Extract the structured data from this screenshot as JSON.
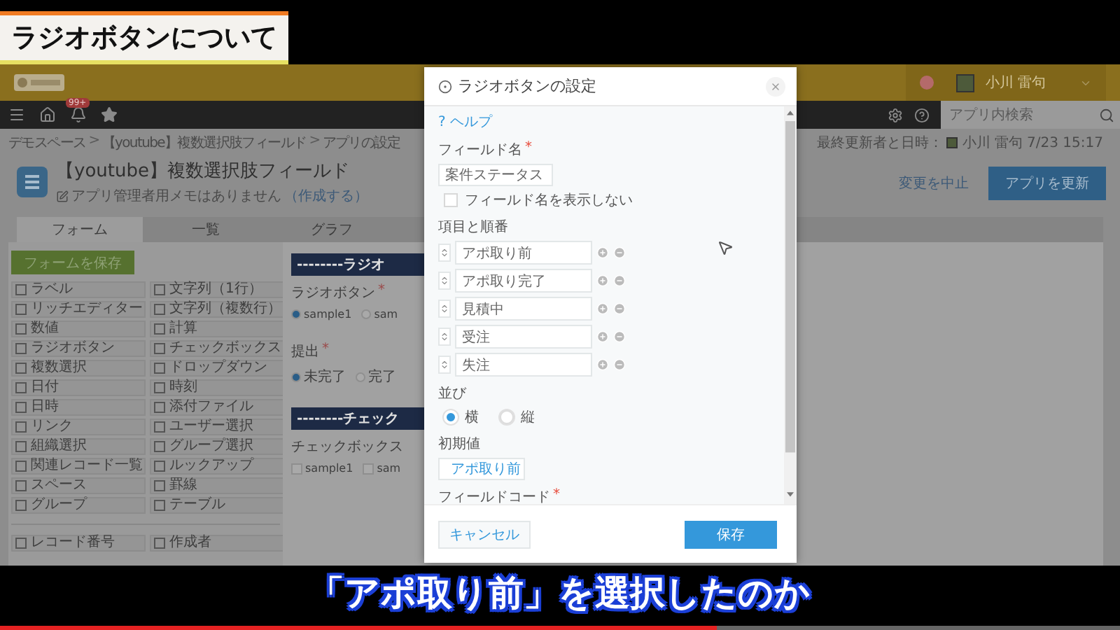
{
  "video_title": "ラジオボタンについて",
  "header": {
    "user_name": "小川 雷句",
    "notification_badge": "99+",
    "search": {
      "placeholder": "アプリ内検索"
    }
  },
  "breadcrumb": [
    {
      "kind": "link",
      "label": "デモスペース"
    },
    {
      "kind": "separator",
      "label": ">"
    },
    {
      "kind": "link",
      "label": "【youtube】複数選択肢フィールド"
    },
    {
      "kind": "separator",
      "label": ">"
    },
    {
      "kind": "link",
      "label": "アプリの設定"
    }
  ],
  "app": {
    "title": "【youtube】複数選択肢フィールド",
    "memo": "アプリ管理者用メモはありません",
    "memo_link": "（作成する）"
  },
  "last_updated": {
    "label": "最終更新者と日時：",
    "user": "小川 雷句",
    "time": "7/23 15:17"
  },
  "actions": {
    "cancel": "変更を中止",
    "update": "アプリを更新"
  },
  "tabs": [
    {
      "label": "フォーム",
      "selected": true
    },
    {
      "label": "一覧",
      "selected": false
    },
    {
      "label": "グラフ",
      "selected": false
    }
  ],
  "palette": {
    "save_button": "フォームを保存",
    "items": [
      "ラベル",
      "文字列（1行）",
      "リッチエディター",
      "文字列（複数行）",
      "数値",
      "計算",
      "ラジオボタン",
      "チェックボックス",
      "複数選択",
      "ドロップダウン",
      "日付",
      "時刻",
      "日時",
      "添付ファイル",
      "リンク",
      "ユーザー選択",
      "組織選択",
      "グループ選択",
      "関連レコード一覧",
      "ルックアップ",
      "スペース",
      "罫線",
      "グループ",
      "テーブル"
    ],
    "system_items": [
      "レコード番号",
      "作成者"
    ]
  },
  "form": {
    "sections": [
      {
        "heading": "--------ラジオ",
        "fields": [
          {
            "kind": "radio",
            "label": "ラジオボタン",
            "required_mark": "*",
            "options": [
              {
                "label": "sample1",
                "selected": true
              },
              {
                "label": "sam",
                "selected": false
              }
            ]
          },
          {
            "kind": "radio",
            "label": "提出",
            "required_mark": "*",
            "options": [
              {
                "label": "未完了",
                "selected": true
              },
              {
                "label": "完了",
                "selected": false
              }
            ]
          }
        ]
      },
      {
        "heading": "--------チェック",
        "fields": [
          {
            "kind": "checkbox",
            "label": "チェックボックス",
            "options": [
              {
                "label": "sample1",
                "checked": false
              },
              {
                "label": "sam",
                "checked": false
              }
            ]
          }
        ]
      }
    ]
  },
  "dialog": {
    "title": "ラジオボタンの設定",
    "help": "? ヘルプ",
    "field_name": {
      "label": "フィールド名",
      "required_mark": "*",
      "value": "案件ステータス"
    },
    "hide_name": {
      "label": "フィールド名を表示しない",
      "checked": false
    },
    "options_label": "項目と順番",
    "options": [
      "アポ取り前",
      "アポ取り完了",
      "見積中",
      "受注",
      "失注"
    ],
    "layout": {
      "label": "並び",
      "choices": [
        {
          "label": "横",
          "selected": true
        },
        {
          "label": "縦",
          "selected": false
        }
      ]
    },
    "default": {
      "label": "初期値",
      "value": "アポ取り前"
    },
    "field_code": {
      "label": "フィールドコード",
      "required_mark": "*"
    },
    "buttons": {
      "cancel": "キャンセル",
      "save": "保存"
    }
  },
  "caption": "「アポ取り前」を選択したのか",
  "video_progress": {
    "level": 0.64
  }
}
